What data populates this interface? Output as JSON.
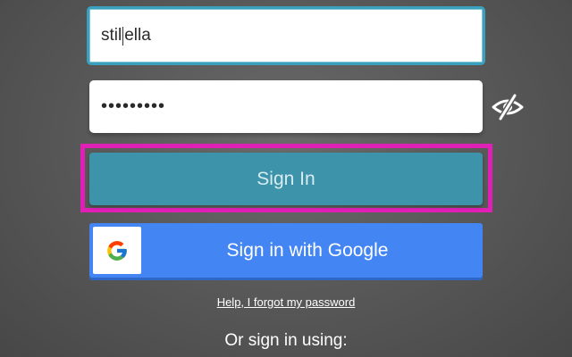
{
  "login": {
    "username_before_caret": "stil",
    "username_after_caret": "ella",
    "password_masked": "•••••••••",
    "signin_label": "Sign In",
    "google_label": "Sign in with Google",
    "forgot_label": "Help, I forgot my password",
    "alt_signin_label": "Or sign in using:"
  },
  "icons": {
    "password_toggle": "eye-slash-icon",
    "google_logo": "google-logo-icon"
  },
  "colors": {
    "focus_border": "#3aa0bd",
    "signin_button": "#3d93a9",
    "highlight_outline": "#e01fb4",
    "google_button": "#4485f4"
  }
}
